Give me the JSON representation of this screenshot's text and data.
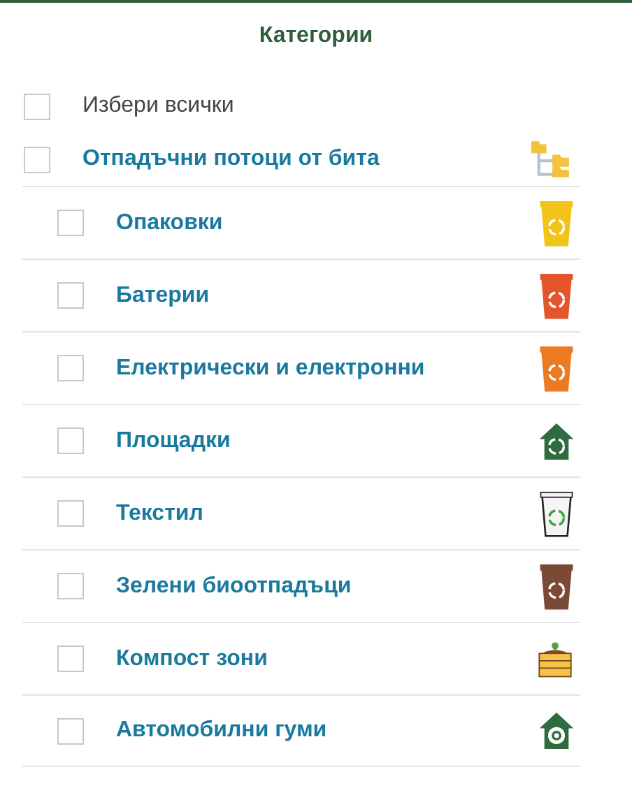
{
  "title": "Категории",
  "select_all": {
    "label": "Избери всички",
    "checked": false
  },
  "group": {
    "label": "Отпадъчни потоци от бита",
    "checked": false,
    "children": [
      {
        "label": "Опаковки",
        "checked": false,
        "kind": "bin",
        "color": "#f2c318"
      },
      {
        "label": "Батерии",
        "checked": false,
        "kind": "bin",
        "color": "#e4552b"
      },
      {
        "label": "Електрически и електронни",
        "checked": false,
        "kind": "bin",
        "color": "#ec7a22"
      },
      {
        "label": "Площадки",
        "checked": false,
        "kind": "house"
      },
      {
        "label": "Текстил",
        "checked": false,
        "kind": "bin",
        "color": "#f4f4f4"
      },
      {
        "label": "Зелени биоотпадъци",
        "checked": false,
        "kind": "bin",
        "color": "#7a4a35"
      },
      {
        "label": "Компост зони",
        "checked": false,
        "kind": "compost"
      },
      {
        "label": "Автомобилни гуми",
        "checked": false,
        "kind": "tire-house"
      }
    ]
  }
}
